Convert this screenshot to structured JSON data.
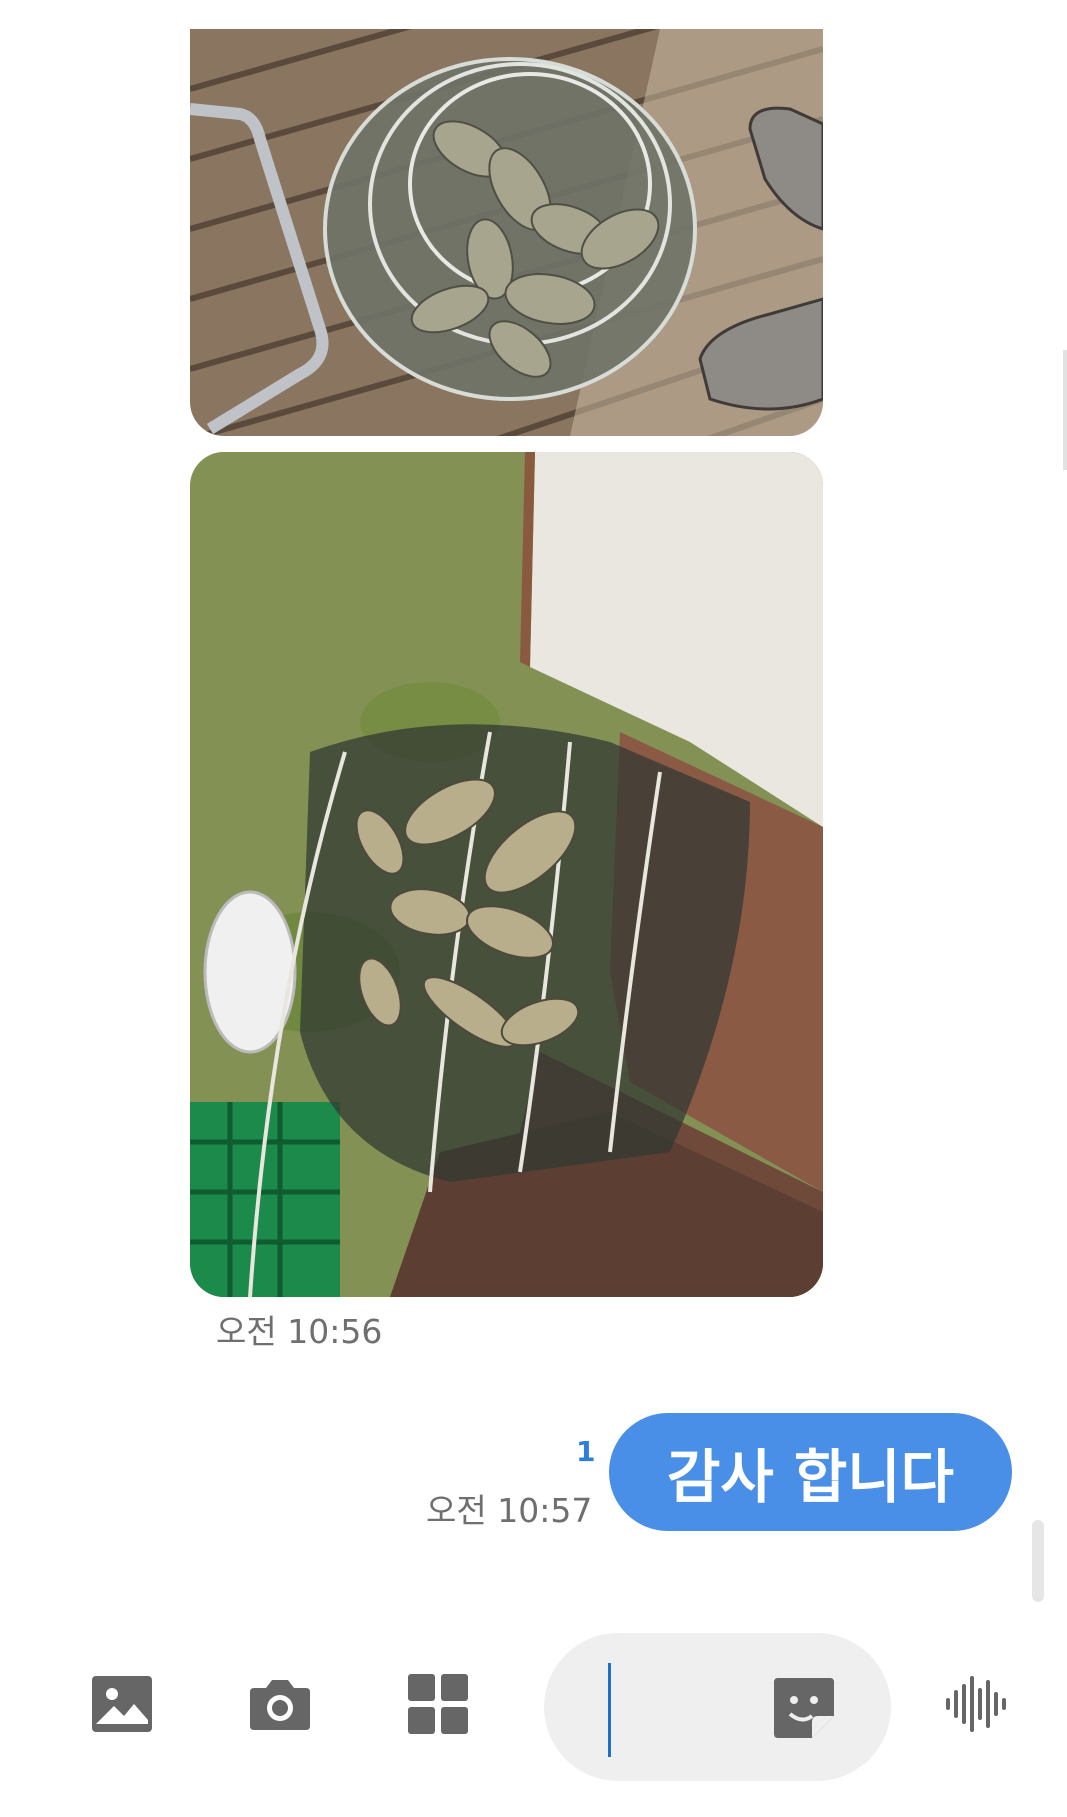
{
  "messages": {
    "received": {
      "photos": [
        {
          "icon": "photo-fish-net-dock"
        },
        {
          "icon": "photo-fish-net-water"
        }
      ],
      "time": "오전 10:56"
    },
    "sent": {
      "text": "감사 합니다",
      "time": "오전 10:57",
      "unread_count": "1"
    }
  },
  "composer": {
    "input_value": "",
    "icons": {
      "gallery": "image-icon",
      "camera": "camera-icon",
      "apps": "apps-grid-icon",
      "sticker": "sticker-icon",
      "voice": "voice-wave-icon"
    }
  },
  "colors": {
    "bubble": "#4a8fe7",
    "unread": "#2f7fd6",
    "icon": "#666666",
    "input_bg": "#efefef"
  }
}
